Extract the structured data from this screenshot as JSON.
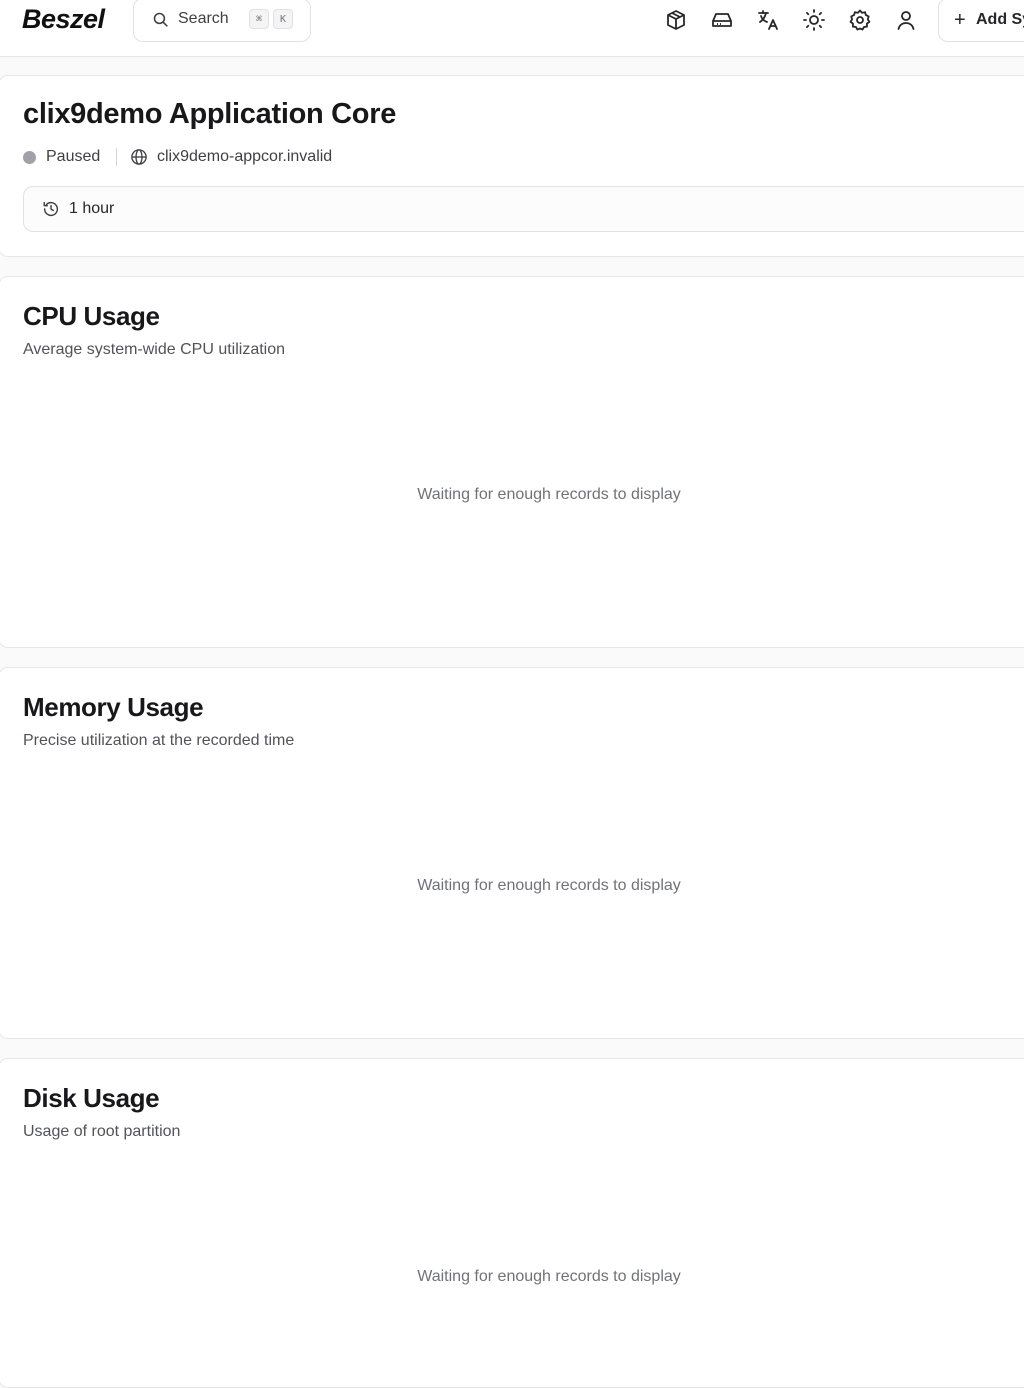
{
  "header": {
    "logo": "Beszel",
    "search_label": "Search",
    "search_shortcut": [
      "⌘",
      "K"
    ],
    "icons": [
      "container-icon",
      "drive-icon",
      "language-icon",
      "theme-sun-icon",
      "settings-gear-icon",
      "user-icon"
    ],
    "add_button_label": "Add Sy"
  },
  "system": {
    "title": "clix9demo Application Core",
    "status": "Paused",
    "status_color": "#a1a1aa",
    "host": "clix9demo-appcor.invalid",
    "time_range": "1 hour"
  },
  "charts": [
    {
      "title": "CPU Usage",
      "subtitle": "Average system-wide CPU utilization",
      "empty_message": "Waiting for enough records to display"
    },
    {
      "title": "Memory Usage",
      "subtitle": "Precise utilization at the recorded time",
      "empty_message": "Waiting for enough records to display"
    },
    {
      "title": "Disk Usage",
      "subtitle": "Usage of root partition",
      "empty_message": "Waiting for enough records to display"
    }
  ]
}
